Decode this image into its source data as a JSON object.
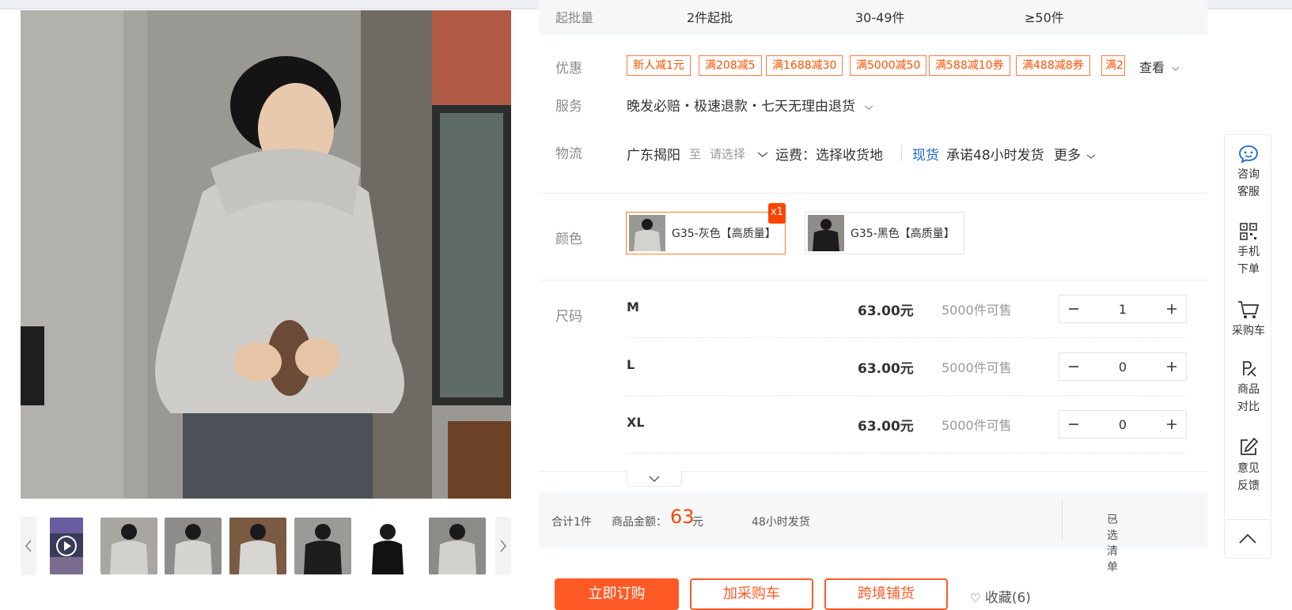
{
  "price_row": {
    "label": "起批量",
    "tiers": [
      "2件起批",
      "30-49件",
      "≥50件"
    ]
  },
  "coupons": {
    "label": "优惠",
    "items": [
      "新人减1元",
      "满208减5",
      "满1688减30",
      "满5000减50",
      "满588减10券",
      "满488减8券",
      "满2"
    ],
    "see_more": "查看"
  },
  "service": {
    "label": "服务",
    "text": "晚发必赔・极速退款・七天无理由退货"
  },
  "logistics": {
    "label": "物流",
    "origin": "广东揭阳",
    "to": "至",
    "select_placeholder": "请选择",
    "fee": "运费：选择收货地",
    "stock_tag": "现货",
    "promise": "承诺48小时发货",
    "more": "更多"
  },
  "color": {
    "label": "颜色",
    "options": [
      {
        "name": "G35-灰色【高质量】",
        "badge": "x1",
        "selected": true
      },
      {
        "name": "G35-黑色【高质量】",
        "badge": "",
        "selected": false
      }
    ]
  },
  "size": {
    "label": "尺码",
    "rows": [
      {
        "name": "M",
        "price": "63.00元",
        "stock": "5000件可售",
        "qty": "1"
      },
      {
        "name": "L",
        "price": "63.00元",
        "stock": "5000件可售",
        "qty": "0"
      },
      {
        "name": "XL",
        "price": "63.00元",
        "stock": "5000件可售",
        "qty": "0"
      }
    ]
  },
  "summary": {
    "total_count": "合计1件",
    "amount_label": "商品金额：",
    "amount": "63",
    "amount_unit": "元",
    "ship": "48小时发货",
    "selected_list": "已选清单"
  },
  "actions": {
    "buy": "立即订购",
    "add_cart": "加采购车",
    "dropship": "跨境铺货",
    "favorite": "收藏(6)"
  },
  "sidebar": {
    "items": [
      {
        "label_1": "咨询",
        "label_2": "客服",
        "icon": "chat-bubble-icon"
      },
      {
        "label_1": "手机",
        "label_2": "下单",
        "icon": "qr-code-icon"
      },
      {
        "label_1": "采购车",
        "label_2": "",
        "icon": "cart-icon"
      },
      {
        "label_1": "商品",
        "label_2": "对比",
        "icon": "compare-icon"
      },
      {
        "label_1": "意见",
        "label_2": "反馈",
        "icon": "edit-icon"
      }
    ],
    "back_to_top_icon": "chevron-up-icon"
  },
  "colors": {
    "accent": "#ff5000",
    "link": "#1a66d6",
    "stroke": "#333333"
  }
}
